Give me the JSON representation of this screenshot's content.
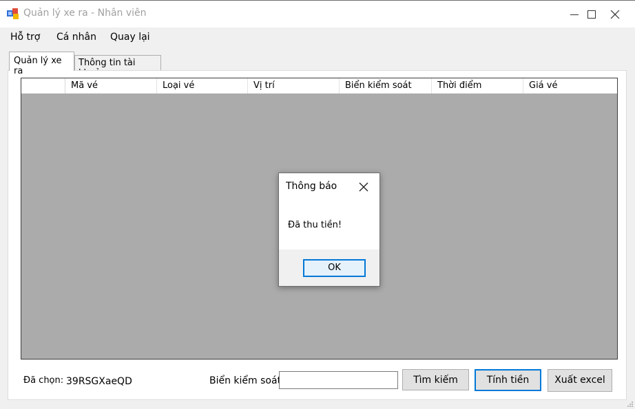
{
  "window": {
    "title": "Quản lý xe ra - Nhân viên",
    "controls": [
      "minimize-icon",
      "maximize-icon",
      "close-icon"
    ]
  },
  "menu": {
    "items": [
      "Hỗ trợ",
      "Cá nhân",
      "Quay lại"
    ]
  },
  "tabs": [
    {
      "label": "Quản lý xe ra",
      "active": true
    },
    {
      "label": "Thông tin tài khoản",
      "active": false
    }
  ],
  "grid": {
    "columns": [
      "Mã vé",
      "Loại vé",
      "Vị trí",
      "Biển kiểm soát",
      "Thời điểm",
      "Giá vé"
    ],
    "rows": []
  },
  "footer": {
    "selected_label": "Đã chọn:",
    "selected_value": "39RSGXaeQD",
    "plate_label": "Biển kiểm soát",
    "plate_input_value": "",
    "search_button": "Tìm kiếm",
    "charge_button": "Tính tiền",
    "export_button": "Xuất excel"
  },
  "dialog": {
    "title": "Thông báo",
    "message": "Đã thu tiền!",
    "ok_button": "OK"
  },
  "colors": {
    "accent": "#0078d7",
    "grid_background": "#ababab",
    "window_background": "#f0f0f0"
  }
}
